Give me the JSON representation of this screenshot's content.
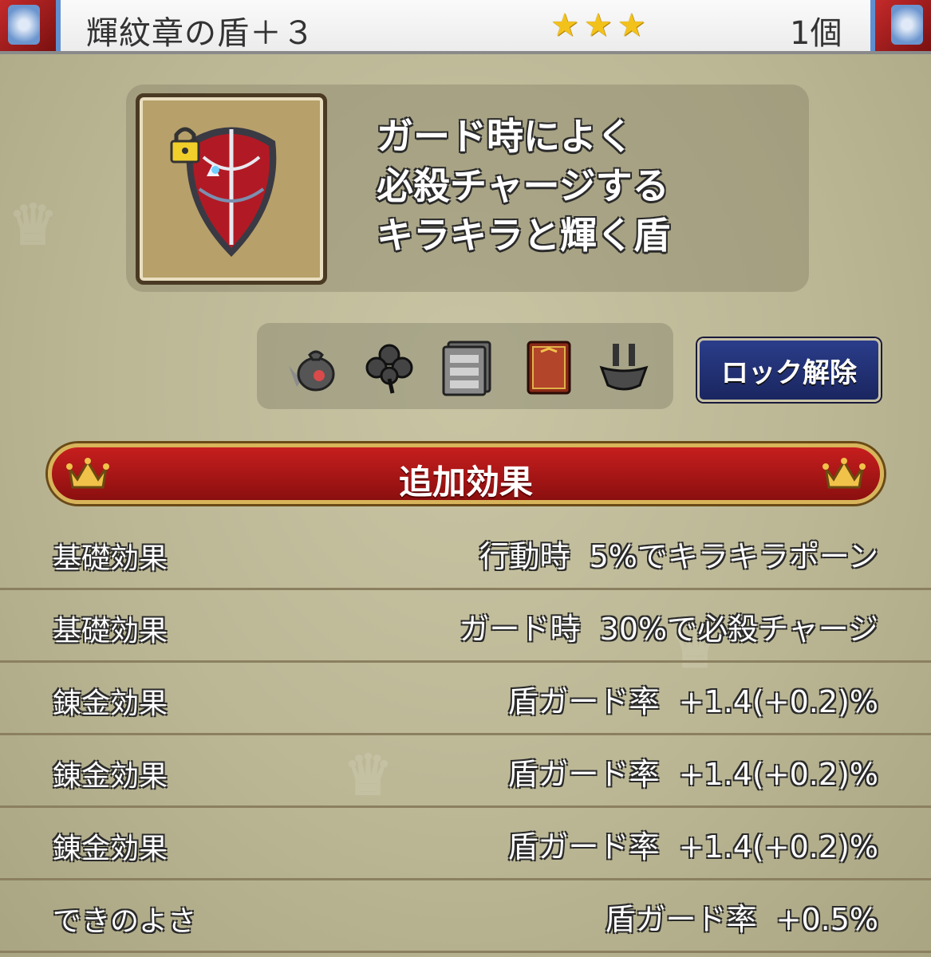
{
  "header": {
    "item_name": "輝紋章の盾＋３",
    "stars": [
      "★",
      "★",
      "★"
    ],
    "count": "1個"
  },
  "item": {
    "icon": "shield-icon",
    "locked": true,
    "description": "ガード時によく\n必殺チャージする\nキラキラと輝く盾"
  },
  "toolbar": {
    "icons": [
      "sell-bag-icon",
      "clover-icon",
      "storage-drawer-icon",
      "book-icon",
      "forge-icon"
    ],
    "unlock_label": "ロック解除"
  },
  "section": {
    "title": "追加効果"
  },
  "effects": [
    {
      "label": "基礎効果",
      "value": "行動時  5%でキラキラポーン"
    },
    {
      "label": "基礎効果",
      "value": "ガード時  30%で必殺チャージ"
    },
    {
      "label": "錬金効果",
      "value": "盾ガード率  +1.4(+0.2)%"
    },
    {
      "label": "錬金効果",
      "value": "盾ガード率  +1.4(+0.2)%"
    },
    {
      "label": "錬金効果",
      "value": "盾ガード率  +1.4(+0.2)%"
    },
    {
      "label": "できのよさ",
      "value": "盾ガード率  +0.5%"
    }
  ],
  "colors": {
    "banner_red": "#b51818",
    "button_navy": "#22307a",
    "star_gold": "#f3c21a"
  }
}
